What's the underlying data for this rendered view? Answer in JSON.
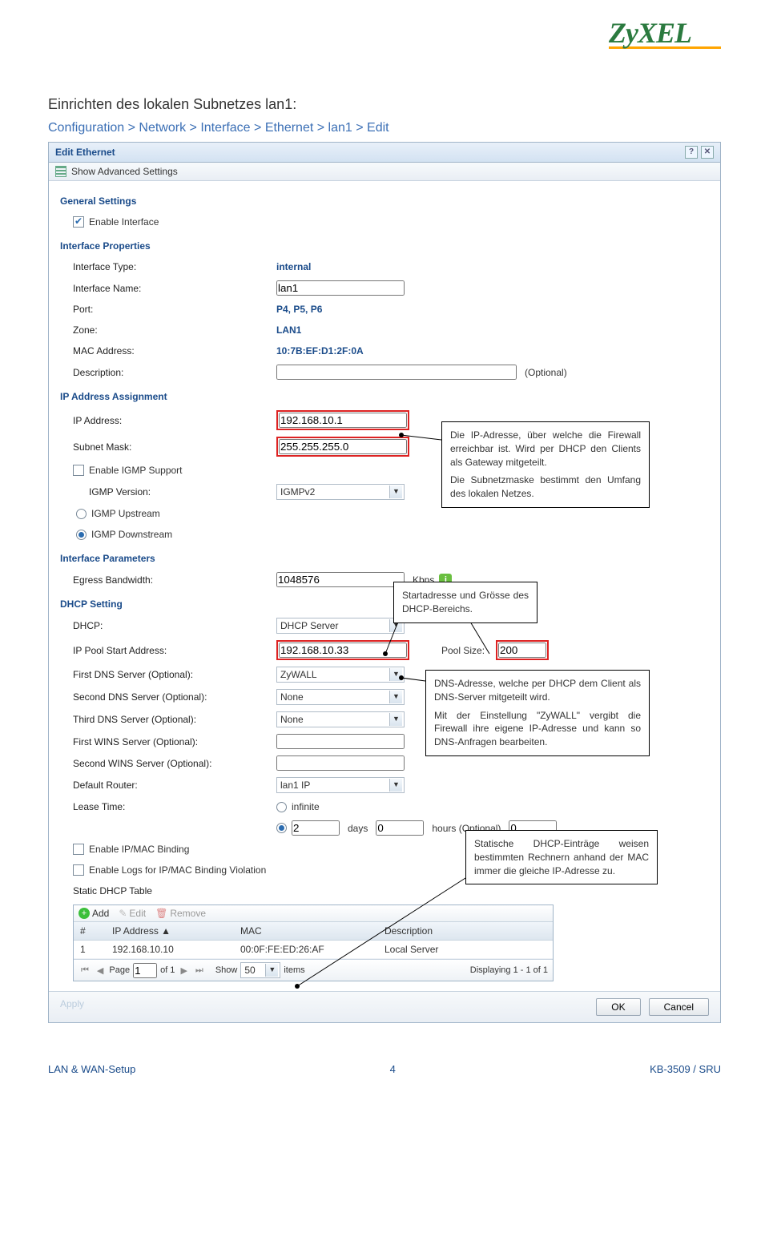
{
  "logo": "ZyXEL",
  "doc_title": "Einrichten des lokalen Subnetzes lan1:",
  "breadcrumb": "Configuration > Network > Interface > Ethernet > lan1 > Edit",
  "window": {
    "title": "Edit Ethernet",
    "toolbar": "Show Advanced Settings"
  },
  "sections": {
    "general": "General Settings",
    "enable_interface": "Enable Interface",
    "interface_props": "Interface Properties",
    "iface_type_lbl": "Interface Type:",
    "iface_type_val": "internal",
    "iface_name_lbl": "Interface Name:",
    "iface_name_val": "lan1",
    "port_lbl": "Port:",
    "port_val": "P4, P5, P6",
    "zone_lbl": "Zone:",
    "zone_val": "LAN1",
    "mac_lbl": "MAC Address:",
    "mac_val": "10:7B:EF:D1:2F:0A",
    "desc_lbl": "Description:",
    "desc_val": "",
    "optional": "(Optional)",
    "ip_assign": "IP Address Assignment",
    "ip_lbl": "IP Address:",
    "ip_val": "192.168.10.1",
    "mask_lbl": "Subnet Mask:",
    "mask_val": "255.255.255.0",
    "igmp_lbl": "Enable IGMP Support",
    "igmp_ver_lbl": "IGMP Version:",
    "igmp_ver_val": "IGMPv2",
    "igmp_up": "IGMP Upstream",
    "igmp_down": "IGMP Downstream",
    "iface_params": "Interface Parameters",
    "egress_lbl": "Egress Bandwidth:",
    "egress_val": "1048576",
    "kbps": "Kbps",
    "dhcp_setting": "DHCP Setting",
    "dhcp_lbl": "DHCP:",
    "dhcp_val": "DHCP Server",
    "pool_lbl": "IP Pool Start Address:",
    "pool_val": "192.168.10.33",
    "pool_size_lbl": "Pool Size:",
    "pool_size_val": "200",
    "dns1_lbl": "First DNS Server (Optional):",
    "dns1_val": "ZyWALL",
    "dns2_lbl": "Second DNS Server (Optional):",
    "dns2_val": "None",
    "dns3_lbl": "Third DNS Server (Optional):",
    "dns3_val": "None",
    "wins1_lbl": "First WINS Server (Optional):",
    "wins1_val": "",
    "wins2_lbl": "Second WINS Server (Optional):",
    "wins2_val": "",
    "defrouter_lbl": "Default Router:",
    "defrouter_val": "lan1 IP",
    "lease_lbl": "Lease Time:",
    "lease_inf": "infinite",
    "lease_days_val": "2",
    "lease_days": "days",
    "lease_hours_val": "0",
    "lease_hours": "hours (Optional)",
    "lease_min_val": "0",
    "ipmac": "Enable IP/MAC Binding",
    "ipmac_log": "Enable Logs for IP/MAC Binding Violation",
    "static_table": "Static DHCP Table",
    "add": "Add",
    "edit": "Edit",
    "remove": "Remove",
    "col_num": "#",
    "col_ip": "IP Address",
    "col_mac": "MAC",
    "col_desc": "Description",
    "row_num": "1",
    "row_ip": "192.168.10.10",
    "row_mac": "00:0F:FE:ED:26:AF",
    "row_desc": "Local Server",
    "page_lbl": "Page",
    "page_val": "1",
    "of": "of 1",
    "show": "Show",
    "show_val": "50",
    "items": "items",
    "displaying": "Displaying 1 - 1 of 1"
  },
  "buttons": {
    "apply": "Apply",
    "ok": "OK",
    "cancel": "Cancel"
  },
  "callouts": {
    "c1": "Die IP-Adresse, über welche die Firewall erreichbar ist. Wird per DHCP den Clients als Gateway mitgeteilt.\nDie Subnetzmaske bestimmt den Umfang des lokalen Netzes.",
    "c2": "Startadresse und Grösse des DHCP-Bereichs.",
    "c3": "DNS-Adresse, welche per DHCP dem Client als DNS-Server mitgeteilt wird.\nMit der Einstellung \"ZyWALL\" vergibt die Firewall ihre eigene IP-Adresse und kann so DNS-Anfragen bearbeiten.",
    "c4": "Statische DHCP-Einträge weisen bestimmten Rechnern anhand der MAC immer die gleiche IP-Adresse zu."
  },
  "footer": {
    "left": "LAN & WAN-Setup",
    "center": "4",
    "right": "KB-3509 / SRU"
  }
}
